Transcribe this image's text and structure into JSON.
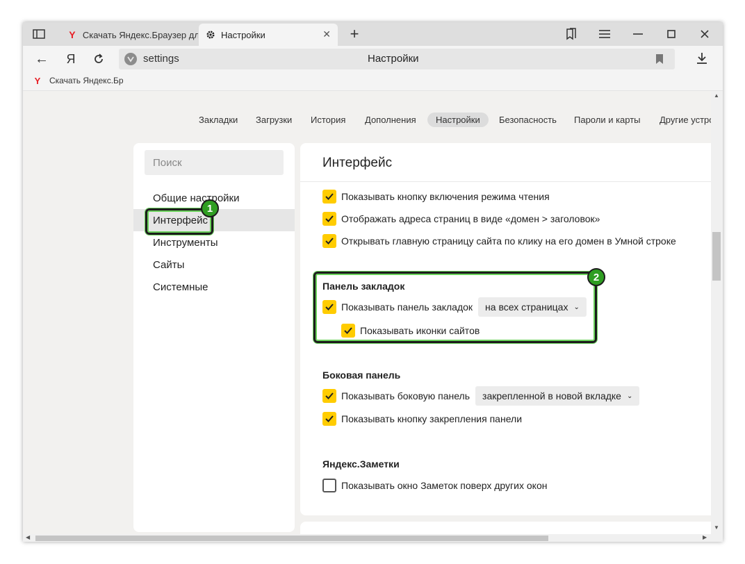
{
  "tabs": [
    {
      "label": "Скачать Яндекс.Браузер дл",
      "icon": "yandex-logo-icon"
    },
    {
      "label": "Настройки",
      "icon": "gear-icon"
    }
  ],
  "window_controls": {
    "bookmarks": "bookmarks-icon",
    "menu": "hamburger-icon",
    "minimize": "minimize-icon",
    "maximize": "maximize-icon",
    "close": "close-icon"
  },
  "address": {
    "brand_glyph": "Я",
    "url": "settings",
    "page_title": "Настройки"
  },
  "bookmarks_bar": [
    {
      "label": "Скачать Яндекс.Бр"
    }
  ],
  "top_nav": [
    "Закладки",
    "Загрузки",
    "История",
    "Дополнения",
    "Настройки",
    "Безопасность",
    "Пароли и карты",
    "Другие устро"
  ],
  "sidebar": {
    "search_placeholder": "Поиск",
    "items": [
      "Общие настройки",
      "Интерфейс",
      "Инструменты",
      "Сайты",
      "Системные"
    ]
  },
  "main": {
    "title": "Интерфейс",
    "interface_options": [
      "Показывать кнопку включения режима чтения",
      "Отображать адреса страниц в виде «домен > заголовок»",
      "Открывать главную страницу сайта по клику на его домен в Умной строке"
    ],
    "bookmarks_panel": {
      "heading": "Панель закладок",
      "show_panel": "Показывать панель закладок",
      "show_panel_select": "на всех страницах",
      "show_icons": "Показывать иконки сайтов"
    },
    "side_panel": {
      "heading": "Боковая панель",
      "show_panel": "Показывать боковую панель",
      "show_panel_select": "закрепленной в новой вкладке",
      "show_pin": "Показывать кнопку закрепления панели"
    },
    "notes": {
      "heading": "Яндекс.Заметки",
      "show_window": "Показывать окно Заметок поверх других окон"
    }
  },
  "callouts": {
    "one": "1",
    "two": "2"
  },
  "colors": {
    "accent": "#ffcc00",
    "callout_green": "#2f9e22"
  }
}
